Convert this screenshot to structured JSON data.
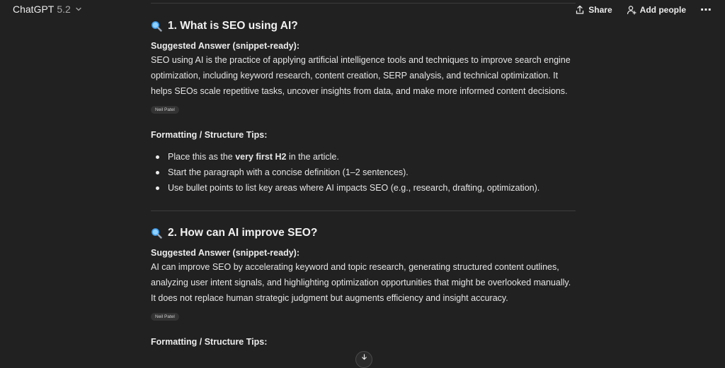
{
  "header": {
    "model_name": "ChatGPT",
    "model_version": "5.2",
    "share_label": "Share",
    "add_people_label": "Add people",
    "more_label": "⋯"
  },
  "sections": [
    {
      "title": "1. What is SEO using AI?",
      "answer_label": "Suggested Answer (snippet-ready):",
      "answer": "SEO using AI is the practice of applying artificial intelligence tools and techniques to improve search engine optimization, including keyword research, content creation, SERP analysis, and technical optimization. It helps SEOs scale repetitive tasks, uncover insights from data, and make more informed content decisions.",
      "citation": "Neil Patel",
      "tips_label": "Formatting / Structure Tips:",
      "tips": [
        {
          "pre": "Place this as the ",
          "bold": "very first H2",
          "post": " in the article."
        },
        {
          "pre": "Start the paragraph with a concise definition (1–2 sentences).",
          "bold": "",
          "post": ""
        },
        {
          "pre": "Use bullet points to list key areas where AI impacts SEO (e.g., research, drafting, optimization).",
          "bold": "",
          "post": ""
        }
      ]
    },
    {
      "title": "2. How can AI improve SEO?",
      "answer_label": "Suggested Answer (snippet-ready):",
      "answer": "AI can improve SEO by accelerating keyword and topic research, generating structured content outlines, analyzing user intent signals, and highlighting optimization opportunities that might be overlooked manually. It does not replace human strategic judgment but augments efficiency and insight accuracy.",
      "citation": "Neil Patel",
      "tips_label": "Formatting / Structure Tips:"
    }
  ],
  "scroll_down_icon": "arrow-down-icon",
  "colors": {
    "background": "#212121",
    "text": "#ececec",
    "citation_bg": "#333333",
    "magnifier": "#4aa8ff"
  }
}
